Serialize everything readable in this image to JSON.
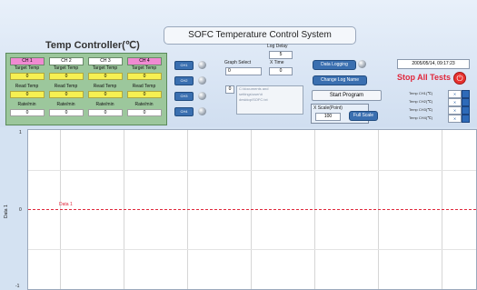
{
  "app_title": "SOFC Temperature Control System",
  "temp_controller": {
    "title": "Temp Controller(℃)",
    "channels": [
      {
        "name": "CH 1",
        "target_label": "Target Temp",
        "target": "0",
        "read_label": "Read Temp",
        "read": "0",
        "rate_label": "Rate/min",
        "rate": "0",
        "color": "#f08ad2"
      },
      {
        "name": "CH 2",
        "target_label": "Target Temp",
        "target": "0",
        "read_label": "Read Temp",
        "read": "0",
        "rate_label": "Rate/min",
        "rate": "0",
        "color": "#ffffff"
      },
      {
        "name": "CH 3",
        "target_label": "Target Temp",
        "target": "0",
        "read_label": "Read Temp",
        "read": "0",
        "rate_label": "Rate/min",
        "rate": "0",
        "color": "#ffffff"
      },
      {
        "name": "CH 4",
        "target_label": "Target Temp",
        "target": "0",
        "read_label": "Read Temp",
        "read": "0",
        "rate_label": "Rate/min",
        "rate": "0",
        "color": "#f08ad2"
      }
    ]
  },
  "enable_buttons": [
    "CH1",
    "CH2",
    "CH3",
    "CH4"
  ],
  "log_delay": {
    "label": "Log Delay",
    "value": "5"
  },
  "graph_select": {
    "label": "Graph Select",
    "value": "0"
  },
  "x_time": {
    "label": "X Time",
    "value": "0"
  },
  "listbox_value": "0",
  "listbox_items": [
    "C:\\documents and",
    "settings\\user\\#",
    "desktop\\SOFC.txt"
  ],
  "data_logging_label": "Data Logging",
  "change_log_name_label": "Change Log Name",
  "start_program_label": "Start Program",
  "x_scale": {
    "label": "X Scale(Point)",
    "value": "100"
  },
  "full_scale_label": "Full Scale",
  "datetime": "2005/05/14,  09:17:23",
  "stop_label": "Stop All Tests",
  "temp_toggles": [
    "Temp CH1(℃)",
    "Temp CH2(℃)",
    "Temp CH3(℃)",
    "Temp CH4(℃)"
  ],
  "chart_data": {
    "type": "line",
    "ylabel": "Data 1",
    "xlabel": "",
    "series": [
      {
        "name": "Data 1",
        "values": [
          0,
          0
        ]
      }
    ],
    "y_ticks": [
      "1",
      "0",
      "-1"
    ],
    "grid": true,
    "colors": {
      "series": "#e0283c"
    }
  }
}
